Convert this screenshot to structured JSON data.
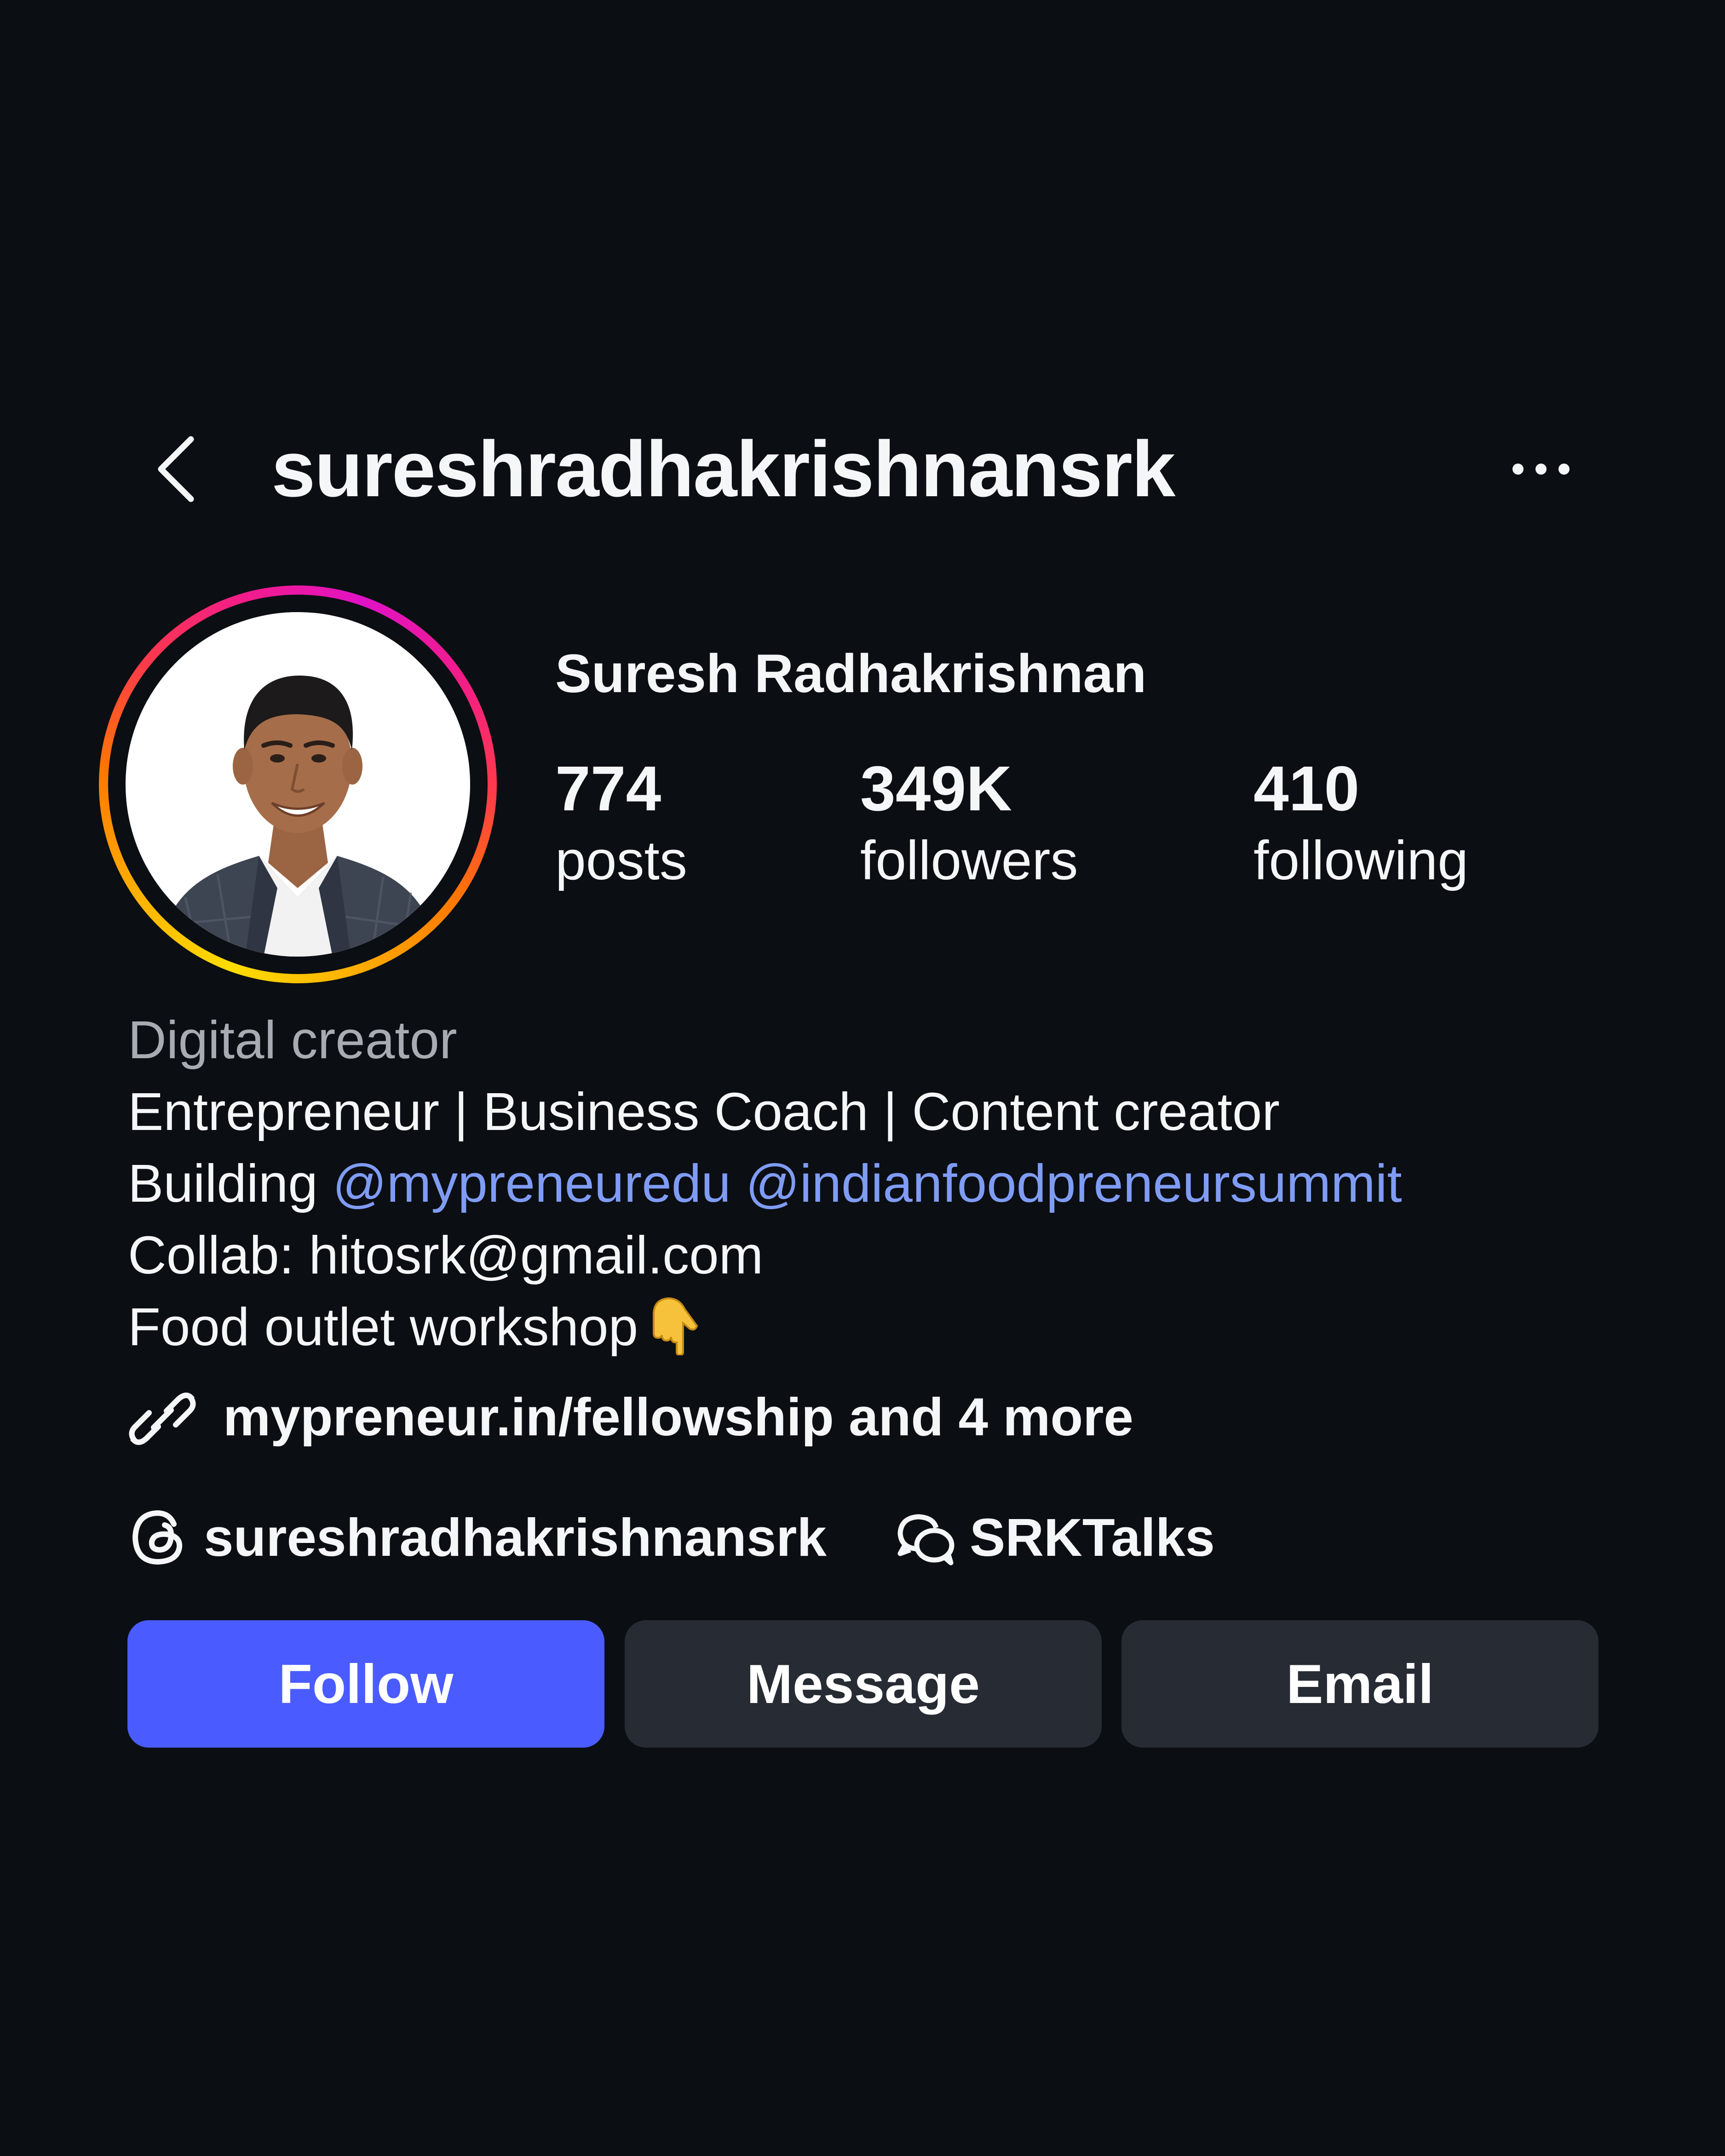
{
  "header": {
    "back_icon": "chevron-left-icon",
    "username": "sureshradhakrishnansrk",
    "more_icon": "more-horizontal-icon"
  },
  "profile": {
    "full_name": "Suresh Radhakrishnan",
    "avatar_ring_colors": [
      "#ffdd00",
      "#ff7a00",
      "#ff3a4a",
      "#e012c6"
    ],
    "stats": {
      "posts": {
        "value": "774",
        "label": "posts"
      },
      "followers": {
        "value": "349K",
        "label": "followers"
      },
      "following": {
        "value": "410",
        "label": "following"
      }
    }
  },
  "bio": {
    "category": "Digital creator",
    "line1": "Entrepreneur | Business Coach | Content creator",
    "line2_prefix": "Building",
    "mention1": "@mypreneuredu",
    "mention2": "@indianfoodpreneursummit",
    "line3": "Collab: hitosrk@gmail.com",
    "line4": "Food outlet workshop",
    "line4_emoji": "backhand-index-pointing-down-icon"
  },
  "links": {
    "icon": "link-icon",
    "text": "mypreneur.in/fellowship and 4 more"
  },
  "social": {
    "threads_icon": "threads-icon",
    "threads_handle": "sureshradhakrishnansrk",
    "channel_icon": "broadcast-channel-icon",
    "channel_name": "SRKTalks"
  },
  "actions": {
    "follow": "Follow",
    "message": "Message",
    "email": "Email"
  },
  "colors": {
    "background": "#0b0e13",
    "follow_button": "#4a5cff",
    "secondary_button": "#272b33",
    "mention": "#7f9cf5",
    "category": "#a8abb2"
  }
}
